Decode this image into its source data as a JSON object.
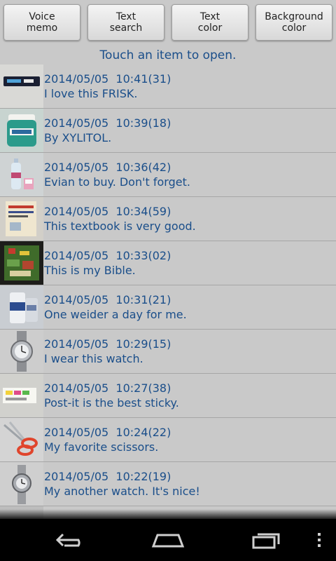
{
  "toolbar": {
    "voice_memo_label": "Voice\nmemo",
    "text_search_label": "Text\nsearch",
    "text_color_label": "Text\ncolor",
    "background_color_label": "Background\ncolor"
  },
  "hint": "Touch an item to open.",
  "memos": [
    {
      "timestamp": "2014/05/05  10:41(31)",
      "text": "I love this FRISK.",
      "icon": "frisk-thumbnail"
    },
    {
      "timestamp": "2014/05/05  10:39(18)",
      "text": "By XYLITOL.",
      "icon": "xylitol-thumbnail"
    },
    {
      "timestamp": "2014/05/05  10:36(42)",
      "text": "Evian to buy. Don't forget.",
      "icon": "evian-thumbnail"
    },
    {
      "timestamp": "2014/05/05  10:34(59)",
      "text": "This textbook is very good.",
      "icon": "textbook-thumbnail"
    },
    {
      "timestamp": "2014/05/05  10:33(02)",
      "text": "This is my Bible.",
      "icon": "bible-thumbnail"
    },
    {
      "timestamp": "2014/05/05  10:31(21)",
      "text": "One weider a day for me.",
      "icon": "weider-thumbnail"
    },
    {
      "timestamp": "2014/05/05  10:29(15)",
      "text": "I wear this watch.",
      "icon": "watch-thumbnail"
    },
    {
      "timestamp": "2014/05/05  10:27(38)",
      "text": "Post-it is the best sticky.",
      "icon": "postit-thumbnail"
    },
    {
      "timestamp": "2014/05/05  10:24(22)",
      "text": "My favorite scissors.",
      "icon": "scissors-thumbnail"
    },
    {
      "timestamp": "2014/05/05  10:22(19)",
      "text": "My another watch. It's nice!",
      "icon": "watch2-thumbnail"
    }
  ],
  "navbar": {
    "back_icon": "back-icon",
    "home_icon": "home-icon",
    "recents_icon": "recents-icon",
    "menu_icon": "overflow-menu-icon"
  },
  "colors": {
    "background": "#c9c9c9",
    "text": "#1a4e8a",
    "navbar": "#000000"
  }
}
